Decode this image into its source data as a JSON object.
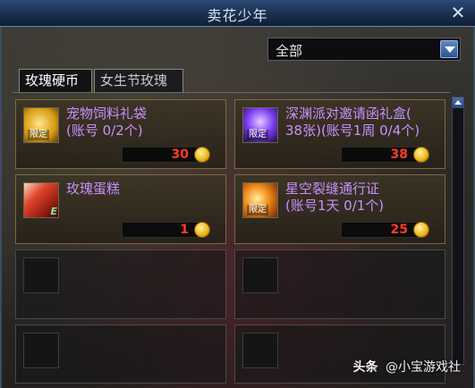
{
  "window": {
    "title": "卖花少年",
    "close_icon": "close-icon"
  },
  "filter": {
    "selected": "全部"
  },
  "tabs": [
    {
      "label": "玫瑰硬币",
      "active": true
    },
    {
      "label": "女生节玫瑰",
      "active": false
    }
  ],
  "items": [
    {
      "name": "宠物饲料礼袋\n(账号 0/2个)",
      "price": "30",
      "tag": "限定",
      "icon": "gold-bag-icon",
      "color": "#f0c33a"
    },
    {
      "name": "深渊派对邀请函礼盒(38张)(账号1周 0/4个)",
      "price": "38",
      "tag": "限定",
      "icon": "purple-gift-box-icon",
      "color": "#8a4cff"
    },
    {
      "name": "玫瑰蛋糕",
      "price": "1",
      "tag": "",
      "icon": "rose-cake-icon",
      "color": "#d43a2a"
    },
    {
      "name": "星空裂缝通行证\n(账号1天 0/1个)",
      "price": "25",
      "tag": "限定",
      "icon": "flame-pass-icon",
      "color": "#f08a18"
    }
  ],
  "watermark": {
    "brand": "头条",
    "account": "@小宝游戏社"
  },
  "colors": {
    "item_name": "#c890ff",
    "price": "#ff3c28",
    "accent": "#2c5496"
  }
}
